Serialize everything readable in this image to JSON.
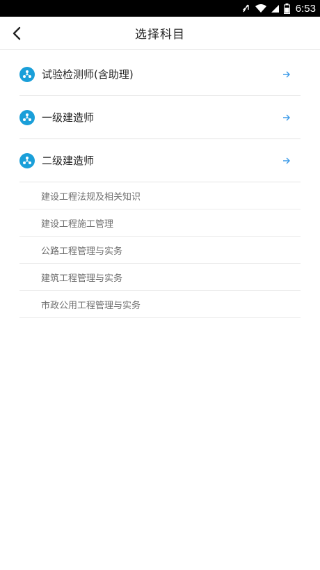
{
  "status_bar": {
    "time": "6:53"
  },
  "header": {
    "title": "选择科目"
  },
  "categories": [
    {
      "label": "试验检测师(含助理)"
    },
    {
      "label": "一级建造师"
    },
    {
      "label": "二级建造师"
    }
  ],
  "subjects": [
    {
      "label": "建设工程法规及相关知识"
    },
    {
      "label": "建设工程施工管理"
    },
    {
      "label": "公路工程管理与实务"
    },
    {
      "label": "建筑工程管理与实务"
    },
    {
      "label": "市政公用工程管理与实务"
    }
  ],
  "colors": {
    "accent": "#1a9fd9",
    "arrow": "#3d9be9"
  }
}
